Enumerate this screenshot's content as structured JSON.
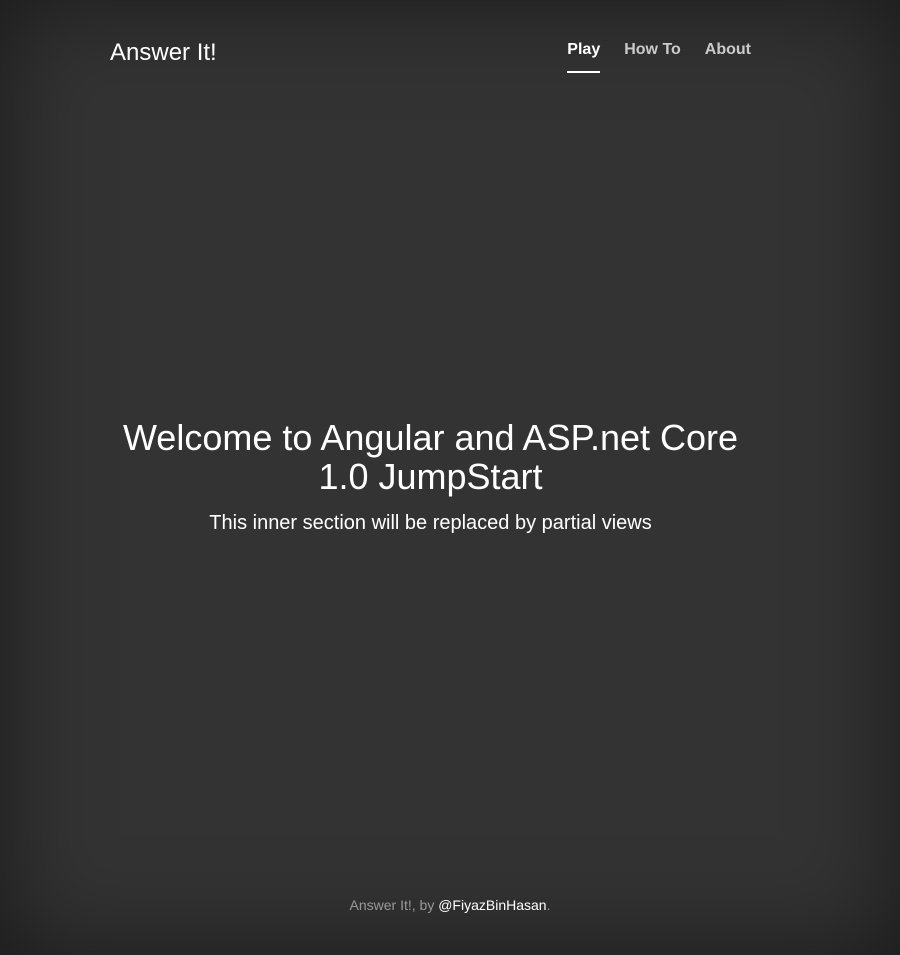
{
  "masthead": {
    "brand": "Answer It!",
    "nav": [
      {
        "label": "Play",
        "active": true
      },
      {
        "label": "How To",
        "active": false
      },
      {
        "label": "About",
        "active": false
      }
    ]
  },
  "cover": {
    "heading": "Welcome to Angular and ASP.net Core 1.0 JumpStart",
    "lead": "This inner section will be replaced by partial views"
  },
  "footer": {
    "prefix": "Answer It!, by ",
    "author_link": "@FiyazBinHasan",
    "suffix": "."
  },
  "colors": {
    "background": "#333333",
    "text": "#ffffff"
  }
}
